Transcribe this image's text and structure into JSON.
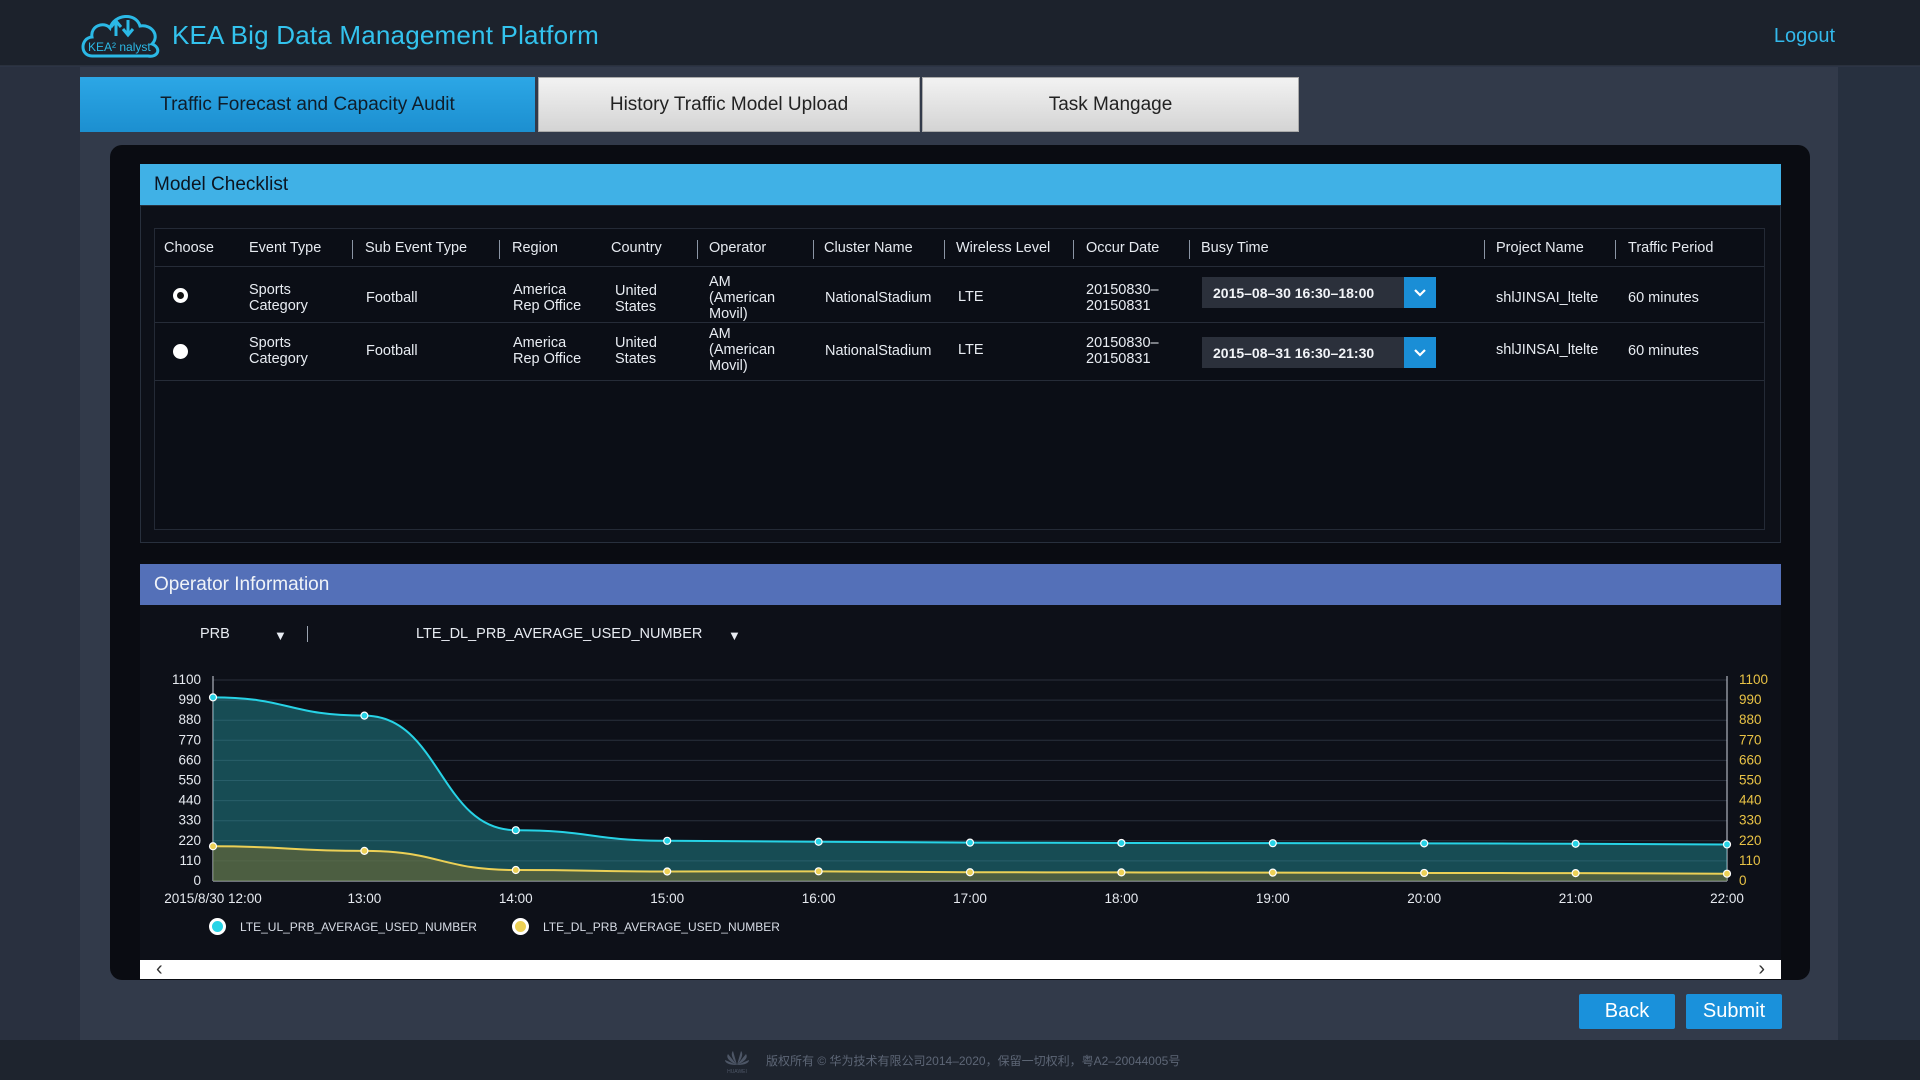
{
  "header": {
    "logo_text": "KEA² nalyst",
    "title": "KEA Big Data Management Platform",
    "logout_label": "Logout"
  },
  "tabs": [
    {
      "label": "Traffic Forecast and Capacity Audit",
      "active": true
    },
    {
      "label": "History Traffic Model Upload",
      "active": false
    },
    {
      "label": "Task Mangage",
      "active": false
    }
  ],
  "model_checklist": {
    "title": "Model Checklist",
    "columns": [
      "Choose",
      "Event Type",
      "Sub Event Type",
      "Region",
      "Country",
      "Operator",
      "Cluster Name",
      "Wireless Level",
      "Occur Date",
      "Busy Time",
      "Project Name",
      "Traffic Period"
    ],
    "rows": [
      {
        "selected": true,
        "event_type": [
          "Sports",
          "Category"
        ],
        "sub_event_type": "Football",
        "region": [
          "America",
          "Rep Office"
        ],
        "country": [
          "United",
          "States"
        ],
        "operator": [
          "AM",
          "(American",
          "Movil)"
        ],
        "cluster_name": "NationalStadium",
        "wireless_level": "LTE",
        "occur_date": [
          "20150830–",
          "20150831"
        ],
        "busy_time": "2015–08–30 16:30–18:00",
        "project_name": "shlJINSAI_ltelte",
        "traffic_period": "60 minutes"
      },
      {
        "selected": false,
        "event_type": [
          "Sports",
          "Category"
        ],
        "sub_event_type": "Football",
        "region": [
          "America",
          "Rep Office"
        ],
        "country": [
          "United",
          "States"
        ],
        "operator": [
          "AM",
          "(American",
          "Movil)"
        ],
        "cluster_name": "NationalStadium",
        "wireless_level": "LTE",
        "occur_date": [
          "20150830–",
          "20150831"
        ],
        "busy_time": "2015–08–31 16:30–21:30",
        "project_name": "shlJINSAI_ltelte",
        "traffic_period": "60 minutes"
      }
    ]
  },
  "operator_info": {
    "title": "Operator Information",
    "category_select": "PRB",
    "metric_select": "LTE_DL_PRB_AVERAGE_USED_NUMBER"
  },
  "chart_data": {
    "type": "area",
    "categories": [
      "2015/8/30 12:00",
      "13:00",
      "14:00",
      "15:00",
      "16:00",
      "17:00",
      "18:00",
      "19:00",
      "20:00",
      "21:00",
      "22:00"
    ],
    "yticks": [
      0,
      110,
      220,
      330,
      440,
      550,
      660,
      770,
      880,
      990,
      1100
    ],
    "ylim": [
      0,
      1100
    ],
    "legend_position": "bottom-left",
    "series": [
      {
        "name": "LTE_UL_PRB_AVERAGE_USED_NUMBER",
        "color": "#27d3e6",
        "values": [
          1005,
          905,
          278,
          220,
          215,
          210,
          208,
          207,
          206,
          204,
          200
        ]
      },
      {
        "name": "LTE_DL_PRB_AVERAGE_USED_NUMBER",
        "color": "#ecd056",
        "values": [
          190,
          165,
          60,
          52,
          53,
          48,
          47,
          46,
          44,
          43,
          40
        ]
      }
    ]
  },
  "buttons": {
    "back_label": "Back",
    "submit_label": "Submit"
  },
  "footer": {
    "brand": "HUAWEI",
    "copyright": "版权所有 © 华为技术有限公司2014–2020，保留一切权利，粤A2–20044005号"
  },
  "colors": {
    "accent": "#1a91db",
    "header_text": "#33c3ee",
    "panel_model": "#40b1e6",
    "panel_operator": "#5470b8"
  }
}
